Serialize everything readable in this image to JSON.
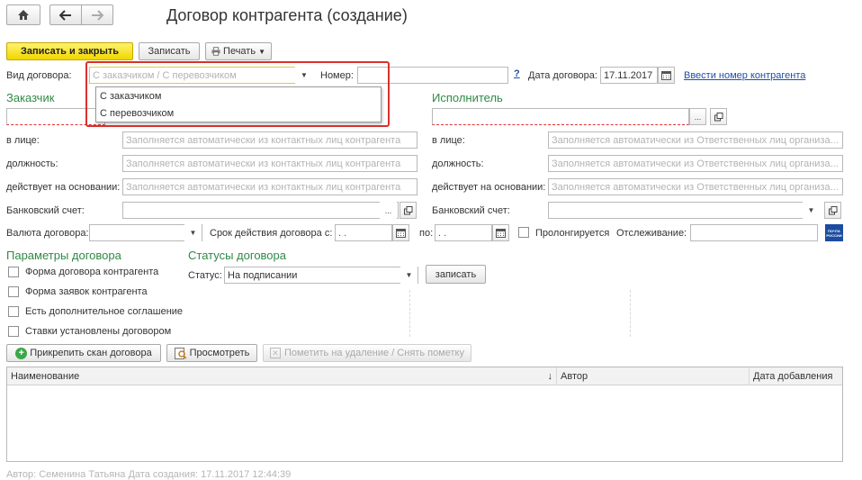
{
  "window": {
    "title": "Договор контрагента (создание)"
  },
  "nav": {
    "home_icon": "home-icon",
    "back_icon": "arrow-left-icon",
    "forward_icon": "arrow-right-icon"
  },
  "toolbar": {
    "save_close_label": "Записать и закрыть",
    "save_label": "Записать",
    "print_label": "Печать"
  },
  "header_fields": {
    "contract_type_label": "Вид договора:",
    "contract_type_placeholder": "С заказчиком / С перевозчиком",
    "contract_type_options": [
      "С заказчиком",
      "С перевозчиком"
    ],
    "number_label": "Номер:",
    "number_value": "",
    "help_label": "?",
    "date_label": "Дата договора:",
    "date_value": "17.11.2017",
    "enter_number_link": "Ввести номер контрагента"
  },
  "customer": {
    "title": "Заказчик",
    "in_person_label": "в лице:",
    "in_person_placeholder": "Заполняется автоматически из контактных лиц контрагента",
    "position_label": "должность:",
    "position_placeholder": "Заполняется автоматически из контактных лиц контрагента",
    "basis_label": "действует на основании:",
    "basis_placeholder": "Заполняется автоматически из контактных лиц контрагента",
    "bank_label": "Банковский счет:"
  },
  "executor": {
    "title": "Исполнитель",
    "in_person_label": "в лице:",
    "in_person_placeholder": "Заполняется автоматически из Ответственных лиц организа...",
    "position_label": "должность:",
    "position_placeholder": "Заполняется автоматически из Ответственных лиц организа...",
    "basis_label": "действует на основании:",
    "basis_placeholder": "Заполняется автоматически из Ответственных лиц организа...",
    "bank_label": "Банковский счет:"
  },
  "terms": {
    "currency_label": "Валюта договора:",
    "period_label": "Срок действия договора с:",
    "period_from": " .  .",
    "to_label": "по:",
    "period_to": " .  .",
    "prolong_label": "Пролонгируется",
    "tracking_label": "Отслеживание:",
    "tracking_value": "",
    "post_logo_text": "ПОЧТА РОССИИ"
  },
  "params": {
    "title": "Параметры договора",
    "checkboxes": [
      "Форма договора контрагента",
      "Форма заявок контрагента",
      "Есть дополнительное соглашение",
      "Ставки установлены договором"
    ]
  },
  "statuses": {
    "title": "Статусы договора",
    "status_label": "Статус:",
    "status_value": "На подписании",
    "write_button": "записать"
  },
  "attachments": {
    "attach_button": "Прикрепить скан договора",
    "view_button": "Просмотреть",
    "mark_delete_button": "Пометить на удаление / Снять пометку",
    "columns": [
      "Наименование",
      "Автор",
      "Дата добавления"
    ],
    "sort_indicator": "↓"
  },
  "footer": {
    "text": "Автор: Семенина Татьяна     Дата создания: 17.11.2017 12:44:39"
  },
  "colors": {
    "accent_green": "#2f8a45",
    "highlight_red": "#d9302c",
    "link_blue": "#1d4ea8",
    "primary_yellow": "#f1d700"
  }
}
